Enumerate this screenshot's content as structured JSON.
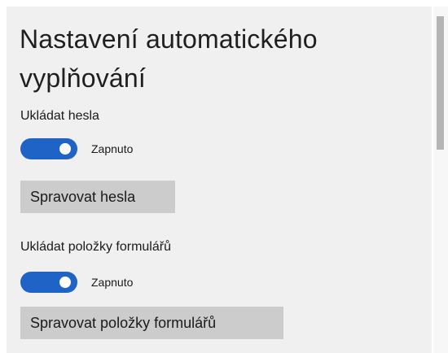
{
  "page": {
    "title": "Nastavení automatického vyplňování"
  },
  "passwords": {
    "label": "Ukládat hesla",
    "toggle_state": "Zapnuto",
    "toggle_on": true,
    "manage_button": "Spravovat hesla"
  },
  "form_entries": {
    "label": "Ukládat položky formulářů",
    "toggle_state": "Zapnuto",
    "toggle_on": true,
    "manage_button": "Spravovat položky formulářů"
  },
  "colors": {
    "accent": "#1f63c6",
    "panel_background": "#f0f0f0",
    "button_background": "#cccccc"
  }
}
